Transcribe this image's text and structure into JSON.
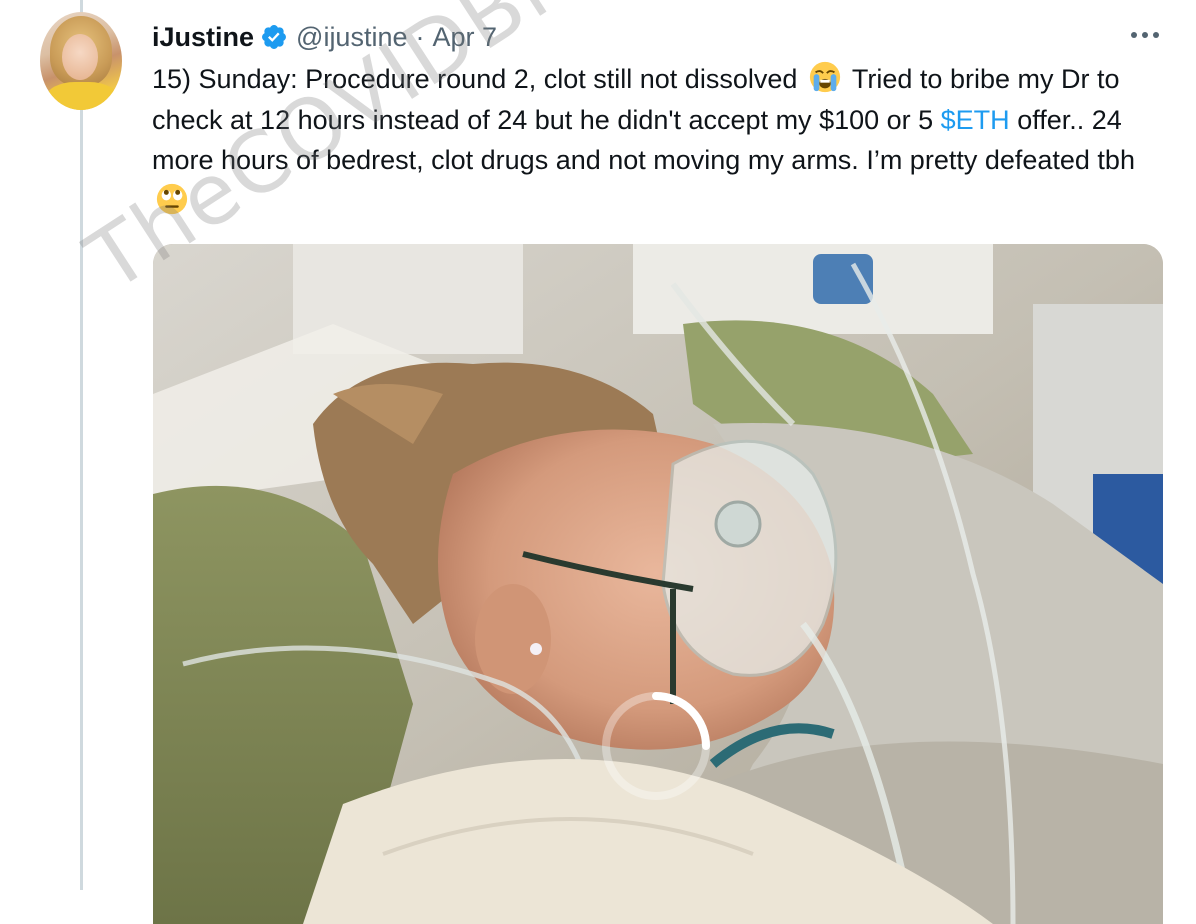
{
  "tweet": {
    "author_name": "iJustine",
    "handle": "@ijustine",
    "separator": "·",
    "date": "Apr 7",
    "text_part1": "15) Sunday: Procedure round 2, clot still not dissolved",
    "text_part2": " Tried to bribe my Dr to check at 12 hours instead of 24 but he didn't accept my $100 or 5 ",
    "cashtag": "$ETH",
    "text_part3": " offer.. 24 more hours of bedrest, clot drugs and not moving my arms. I’m pretty defeated tbh",
    "emoji_1": "loudly-crying-face",
    "emoji_2": "face-with-rolling-eyes"
  },
  "icons": {
    "verified": "verified-badge-icon",
    "more": "more-options-icon",
    "loading": "loading-spinner-icon"
  },
  "colors": {
    "link": "#1d9bf0",
    "secondary_text": "#536471",
    "thread_line": "#cfd9de"
  },
  "watermark": {
    "text": "TheCOVIDBlog.com"
  }
}
